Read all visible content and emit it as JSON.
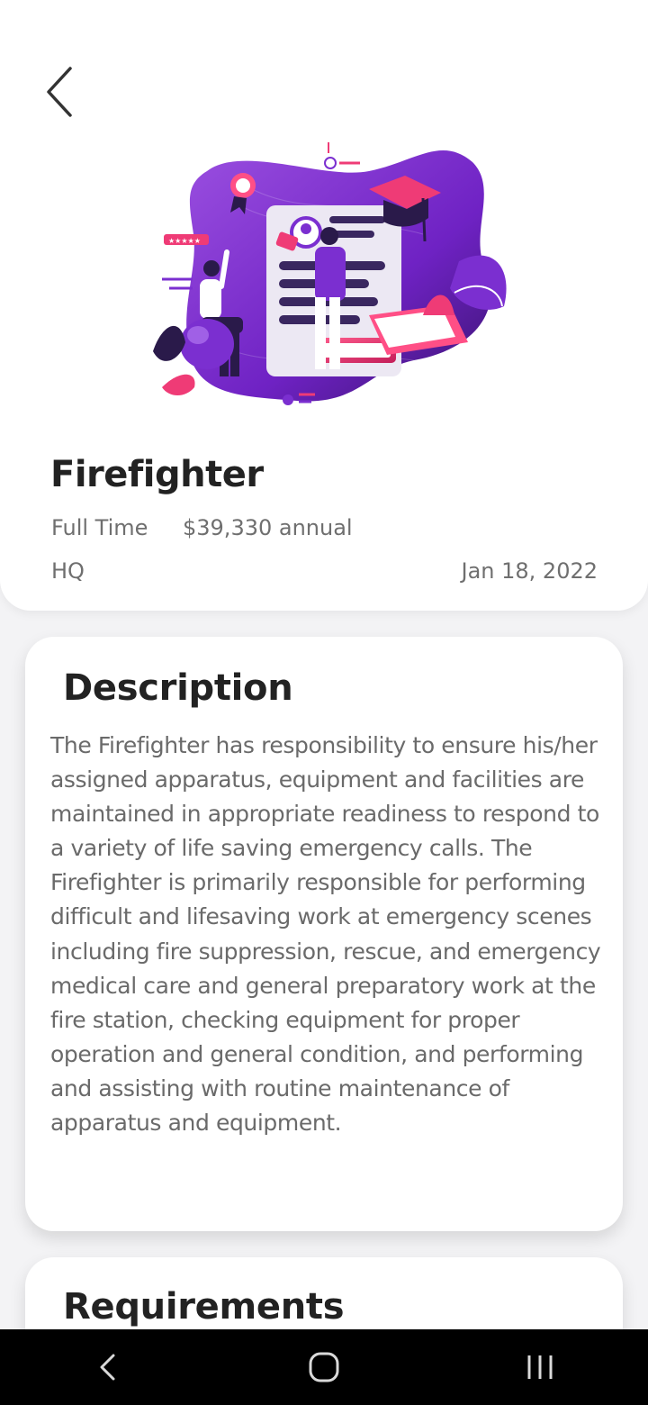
{
  "job": {
    "title": "Firefighter",
    "employment_type": "Full Time",
    "salary": "$39,330 annual",
    "location": "HQ",
    "posted_date": "Jan 18, 2022"
  },
  "description": {
    "heading": "Description",
    "text": "The Firefighter has responsibility to ensure his/her assigned apparatus, equipment and facilities are maintained in appropriate readiness to respond to a variety of life saving emergency calls. The Firefighter is primarily responsible for performing difficult and lifesaving work at emergency scenes including fire suppression, rescue, and emergency medical care and general preparatory work at the fire station, checking equipment for proper operation and general condition, and performing and assisting with routine maintenance of apparatus and equipment."
  },
  "requirements": {
    "heading": "Requirements"
  },
  "icons": {
    "back": "chevron-left-icon",
    "nav_back": "nav-back-icon",
    "nav_home": "nav-home-icon",
    "nav_recents": "nav-recents-icon"
  },
  "colors": {
    "accent_purple": "#7b2fd0",
    "accent_pink": "#f0437a",
    "text_dark": "#222222",
    "text_muted": "#6f6f6f"
  }
}
